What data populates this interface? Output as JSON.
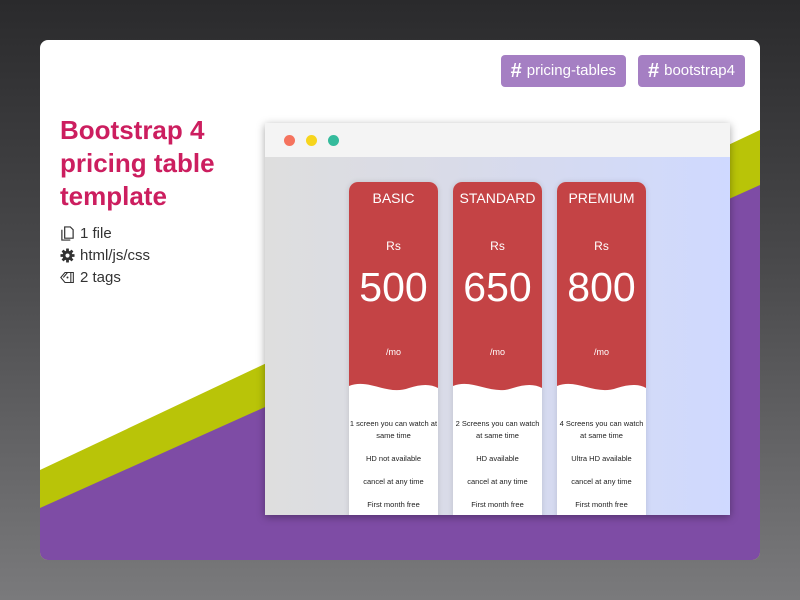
{
  "tags": [
    "pricing-tables",
    "bootstrap4"
  ],
  "title": "Bootstrap 4 pricing table template",
  "meta": {
    "files": "1 file",
    "languages": "html/js/css",
    "tag_count": "2 tags"
  },
  "colors": {
    "accent_title": "#cc1e5f",
    "tag_bg": "#a57fc3",
    "stripe_green": "#b9c408",
    "stripe_purple": "#7e4ca5",
    "plan_red": "#c44345"
  },
  "icons": {
    "tag": "hash-icon",
    "files": "file-icon",
    "languages": "gear-icon",
    "tags": "tag-icon"
  },
  "plans": [
    {
      "name": "BASIC",
      "currency": "Rs",
      "price": "500",
      "period": "/mo",
      "features": [
        "1 screen you can watch at same time",
        "HD not available",
        "cancel at any time",
        "First month free"
      ]
    },
    {
      "name": "STANDARD",
      "currency": "Rs",
      "price": "650",
      "period": "/mo",
      "features": [
        "2 Screens you can watch at same time",
        "HD available",
        "cancel at any time",
        "First month free"
      ]
    },
    {
      "name": "PREMIUM",
      "currency": "Rs",
      "price": "800",
      "period": "/mo",
      "features": [
        "4 Screens you can watch at same time",
        "Ultra HD available",
        "cancel at any time",
        "First month free"
      ]
    }
  ]
}
